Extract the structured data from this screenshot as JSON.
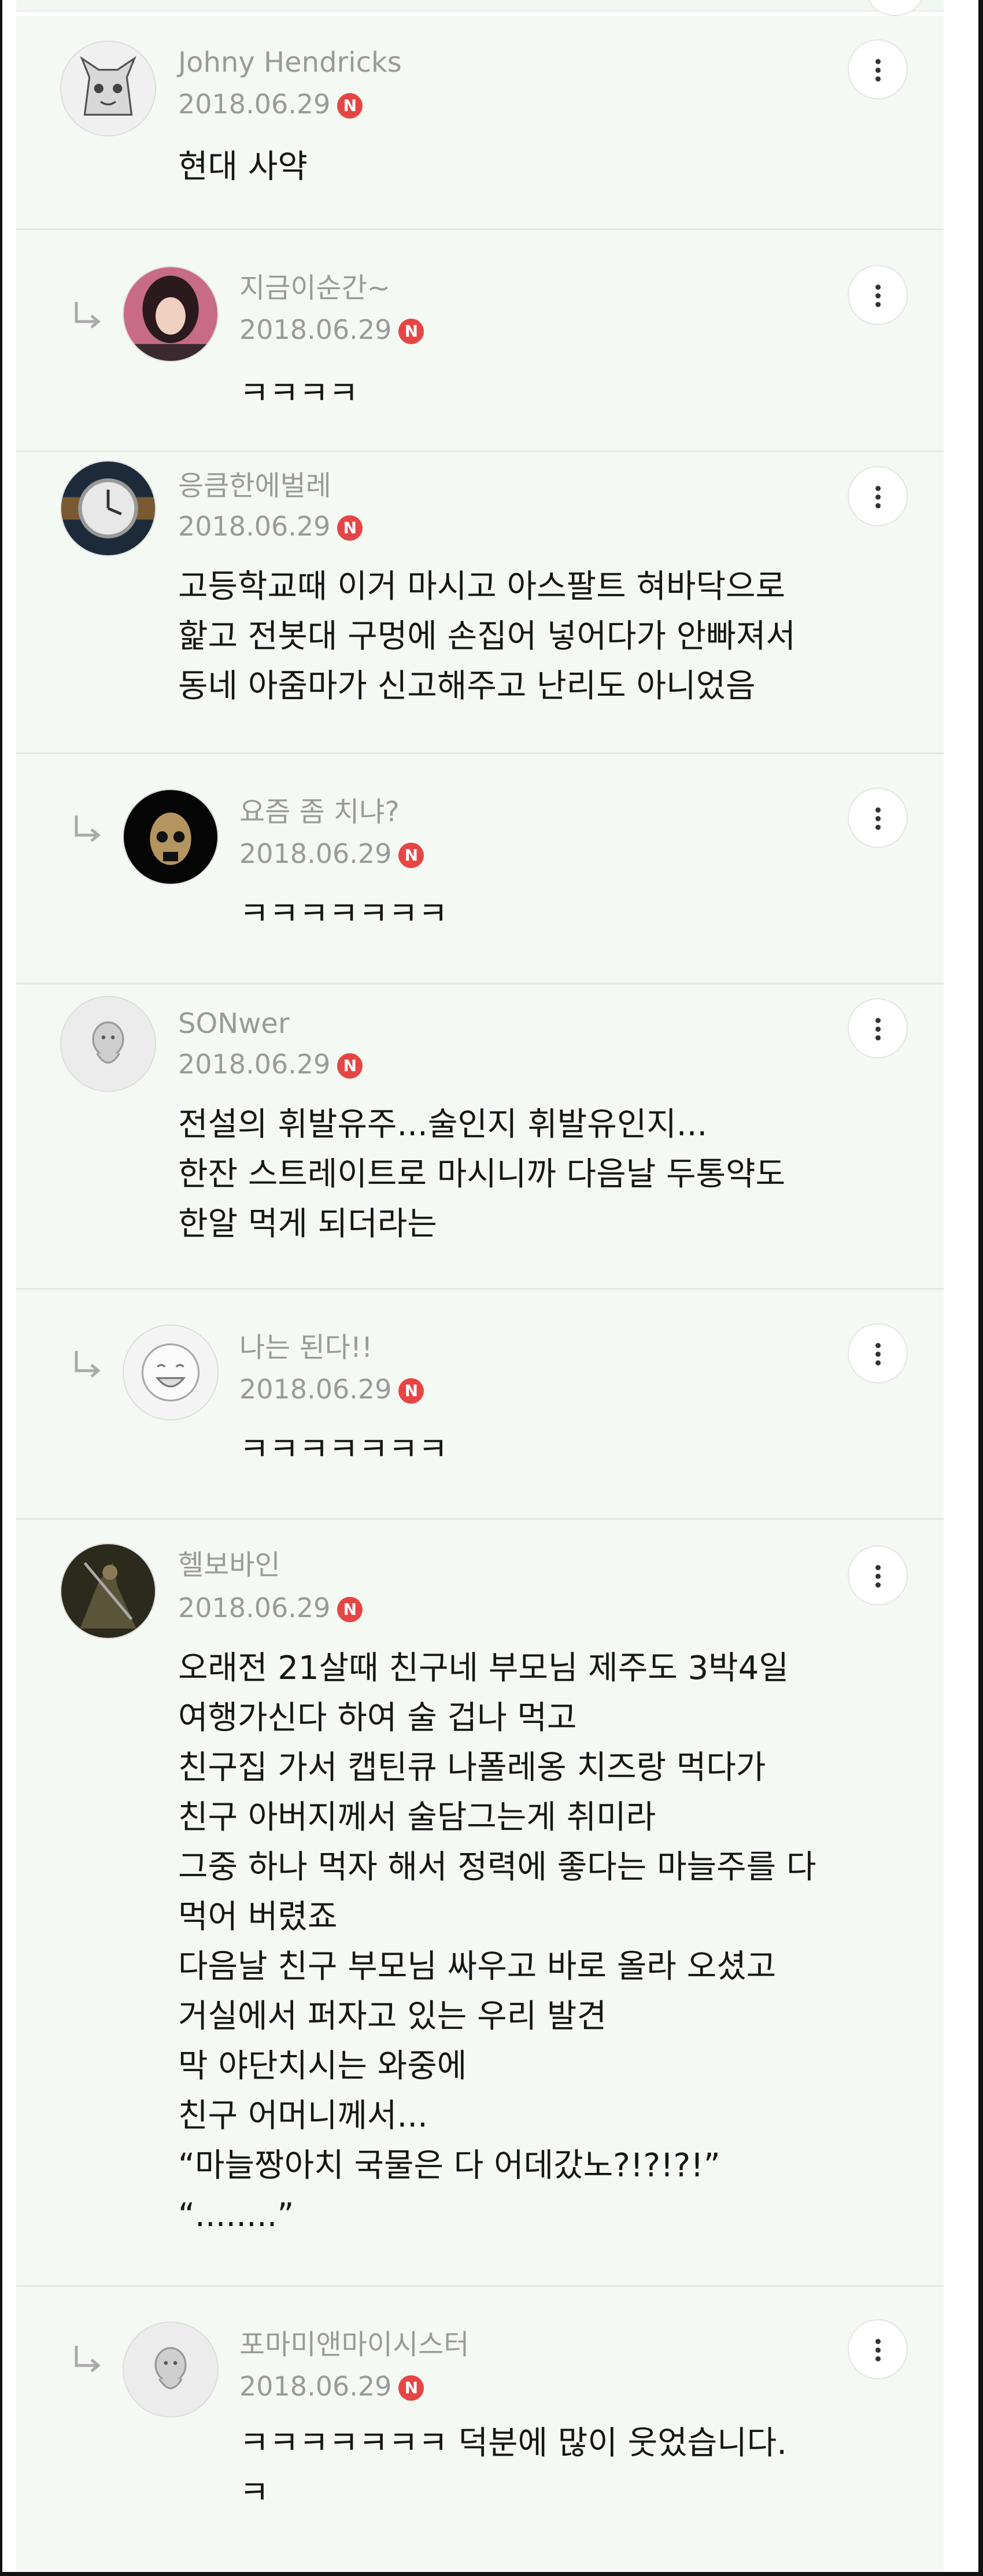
{
  "comments": [
    {
      "nickname": "Johny Hendricks",
      "date": "2018.06.29",
      "badge": "N",
      "avatar_icon": "cartoon-cat-icon",
      "reply": false,
      "lines": [
        "현대 사약"
      ]
    },
    {
      "nickname": "지금이순간~",
      "date": "2018.06.29",
      "badge": "N",
      "avatar_icon": "profile-photo-icon",
      "reply": true,
      "lines": [
        "ㅋㅋㅋㅋ"
      ]
    },
    {
      "nickname": "응큼한에벌레",
      "date": "2018.06.29",
      "badge": "N",
      "avatar_icon": "wristwatch-photo-icon",
      "reply": false,
      "lines": [
        "고등학교때 이거 마시고 아스팔트 혀바닥으로",
        "핥고 전봇대 구멍에 손집어 넣어다가 안빠져서",
        "동네 아줌마가 신고해주고 난리도 아니었음"
      ]
    },
    {
      "nickname": "요즘 좀 치냐?",
      "date": "2018.06.29",
      "badge": "N",
      "avatar_icon": "skull-icon",
      "reply": true,
      "lines": [
        "ㅋㅋㅋㅋㅋㅋㅋ"
      ]
    },
    {
      "nickname": "SONwer",
      "date": "2018.06.29",
      "badge": "N",
      "avatar_icon": "default-character-icon",
      "reply": false,
      "lines": [
        "전설의 휘발유주...술인지 휘발유인지...",
        "한잔 스트레이트로 마시니까 다음날 두통약도",
        "한알 먹게 되더라는"
      ]
    },
    {
      "nickname": "나는 된다!!",
      "date": "2018.06.29",
      "badge": "N",
      "avatar_icon": "laughing-face-icon",
      "reply": true,
      "lines": [
        "ㅋㅋㅋㅋㅋㅋㅋ"
      ]
    },
    {
      "nickname": "헬보바인",
      "date": "2018.06.29",
      "badge": "N",
      "avatar_icon": "warrior-artwork-icon",
      "reply": false,
      "lines": [
        "오래전 21살때 친구네 부모님 제주도 3박4일",
        "여행가신다 하여 술 겁나 먹고",
        "친구집 가서 캡틴큐 나폴레옹 치즈랑 먹다가",
        "친구 아버지께서 술담그는게 취미라",
        "그중 하나 먹자 해서 정력에 좋다는 마늘주를 다",
        "먹어 버렸죠",
        "다음날 친구 부모님 싸우고 바로 올라 오셨고",
        "거실에서 퍼자고 있는 우리 발견",
        "막 야단치시는 와중에",
        "친구 어머니께서...",
        "“마늘짱아치 국물은 다 어데갔노?!?!?!”",
        "“........”"
      ]
    },
    {
      "nickname": "포마미앤마이시스터",
      "date": "2018.06.29",
      "badge": "N",
      "avatar_icon": "default-character-icon",
      "reply": true,
      "lines": [
        "ㅋㅋㅋㅋㅋㅋㅋ 덕분에 많이 웃었습니다.",
        "ㅋ"
      ]
    }
  ],
  "colors": {
    "card_bg": "#f4f9f3",
    "badge_red": "#e64545",
    "meta_gray": "#9a9a9a",
    "text": "#161616"
  }
}
